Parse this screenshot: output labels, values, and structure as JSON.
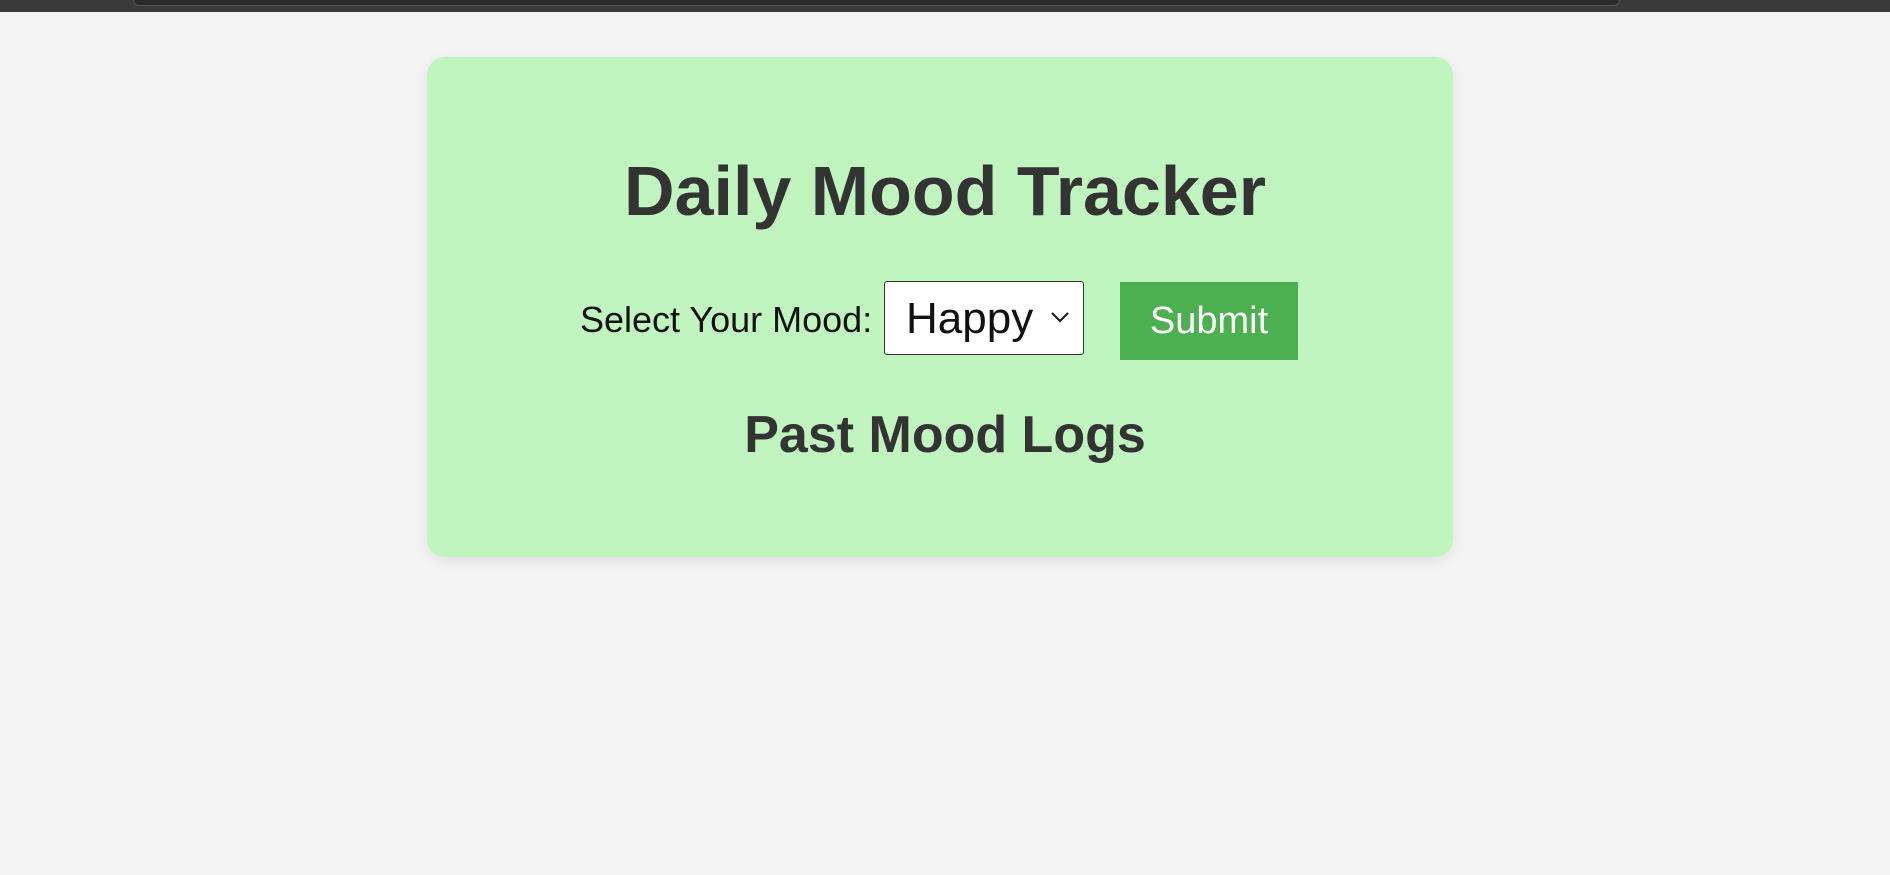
{
  "app": {
    "title": "Daily Mood Tracker"
  },
  "form": {
    "label": "Select Your Mood:",
    "selected_mood": "Happy",
    "submit_label": "Submit"
  },
  "logs": {
    "heading": "Past Mood Logs",
    "entries": []
  },
  "colors": {
    "page_background": "#f4f4f4",
    "card_background": "#c1f5bf",
    "heading_text": "#333333",
    "submit_button": "#4caf50",
    "submit_text": "#ffffff"
  },
  "icons": {
    "select_chevron": "chevron-down-icon"
  }
}
